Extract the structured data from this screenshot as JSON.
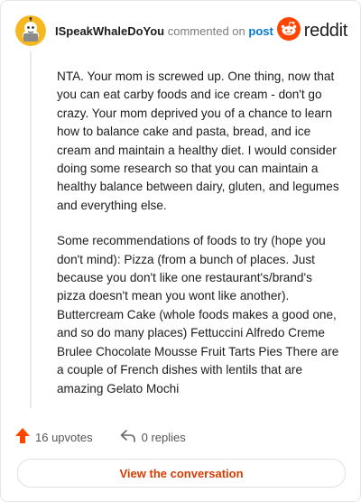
{
  "header": {
    "username": "ISpeakWhaleDoYou",
    "commented_text": "commented on",
    "post_link": "post",
    "brand": "reddit"
  },
  "comment": {
    "paragraphs": [
      "NTA. Your mom is screwed up. One thing, now that you can eat carby foods and ice cream - don't go crazy. Your mom deprived you of a chance to learn how to balance cake and pasta, bread, and ice cream and maintain a healthy diet. I would consider doing some research so that you can maintain a healthy balance between dairy, gluten, and legumes and everything else.",
      "Some recommendations of foods to try (hope you don't mind): Pizza (from a bunch of places. Just because you don't like one restaurant's/brand's pizza doesn't mean you wont like another). Buttercream Cake (whole foods makes a good one, and so do many places) Fettuccini Alfredo Creme Brulee Chocolate Mousse Fruit Tarts Pies There are a couple of French dishes with lentils that are amazing Gelato Mochi"
    ]
  },
  "actions": {
    "upvotes": "16 upvotes",
    "replies": "0 replies"
  },
  "button": {
    "label": "View the conversation"
  },
  "colors": {
    "accent": "#ff4500",
    "link": "#0079d3",
    "button_text": "#d93a00"
  },
  "icons": [
    "snoo-avatar-icon",
    "reddit-logo-icon",
    "upvote-arrow-icon",
    "reply-arrow-icon"
  ]
}
